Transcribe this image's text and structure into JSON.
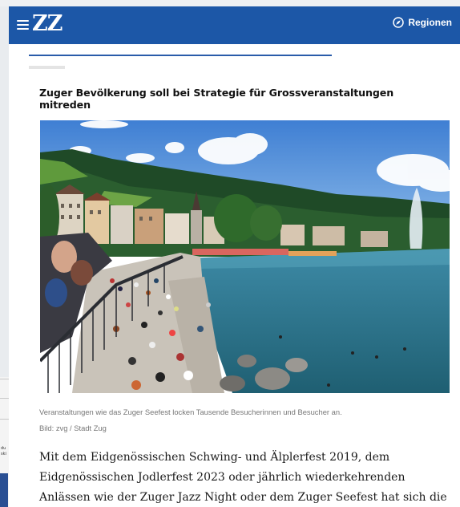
{
  "header": {
    "logo": "ZZ",
    "regions_label": "Regionen",
    "background_color": "#1c57a7"
  },
  "article": {
    "headline": "Zuger Bevölkerung soll bei Strategie für Grossveranstaltungen mitreden",
    "image_caption": "Veranstaltungen wie das Zuger Seefest locken Tausende Besucherinnen und Besucher an.",
    "image_credit": "Bild: zvg / Stadt Zug",
    "lead_lines": [
      "Mit dem Eidgenössischen Schwing- und Älplerfest 2019, dem",
      "Eidgenössischen Jodlerfest 2023 oder jährlich wiederkehrenden",
      "Anlässen wie der Zuger Jazz Night oder dem Zuger Seefest hat sich die"
    ]
  },
  "icons": {
    "menu": "hamburger-menu-icon",
    "regions": "compass-icon"
  }
}
